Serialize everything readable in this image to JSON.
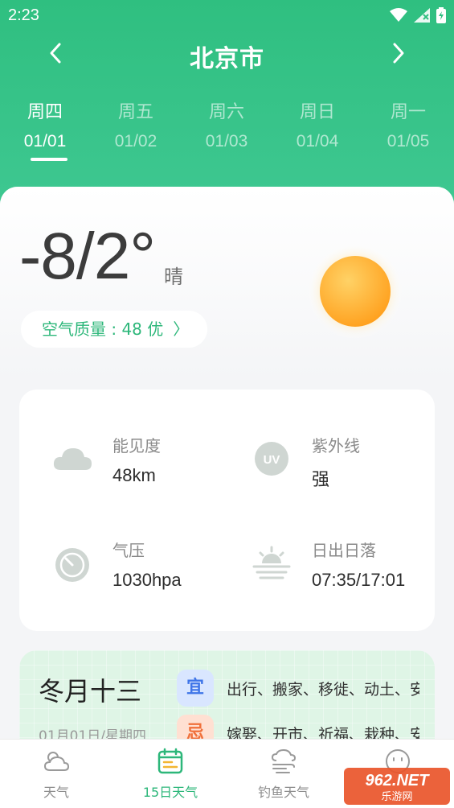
{
  "status_bar": {
    "time": "2:23"
  },
  "nav": {
    "city": "北京市",
    "back_icon": "chevron-left-icon",
    "forward_icon": "chevron-right-icon"
  },
  "days": [
    {
      "weekday": "周四",
      "date": "01/01",
      "active": true
    },
    {
      "weekday": "周五",
      "date": "01/02",
      "active": false
    },
    {
      "weekday": "周六",
      "date": "01/03",
      "active": false
    },
    {
      "weekday": "周日",
      "date": "01/04",
      "active": false
    },
    {
      "weekday": "周一",
      "date": "01/05",
      "active": false
    }
  ],
  "current": {
    "temperature": "-8/2°",
    "condition": "晴",
    "condition_icon": "sun-icon",
    "air_quality": "空气质量 : 48 优",
    "air_quality_chevron": "〉"
  },
  "details": {
    "visibility": {
      "label": "能见度",
      "value": "48km",
      "icon": "cloud-icon"
    },
    "uv": {
      "label": "紫外线",
      "value": "强",
      "icon": "uv-icon",
      "icon_text": "UV"
    },
    "pressure": {
      "label": "气压",
      "value": "1030hpa",
      "icon": "gauge-icon"
    },
    "sunrise_sunset": {
      "label": "日出日落",
      "value": "07:35/17:01",
      "icon": "sunrise-icon"
    }
  },
  "almanac": {
    "lunar_day": "冬月十三",
    "date_line": "01月01日/星期四",
    "yi_label": "宜",
    "yi_items": "出行、搬家、移徙、动土、安",
    "ji_label": "忌",
    "ji_items": "嫁娶、开市、祈福、栽种、安"
  },
  "tabs": [
    {
      "label": "天气",
      "icon": "cloud-sun-icon",
      "active": false
    },
    {
      "label": "15日天气",
      "icon": "calendar-icon",
      "active": true
    },
    {
      "label": "钓鱼天气",
      "icon": "wind-cloud-icon",
      "active": false
    },
    {
      "label": "",
      "icon": "face-icon",
      "active": false
    }
  ],
  "colors": {
    "header_green": "#2fbf80",
    "accent_green": "#2db77a",
    "yi_blue": "#3f75e8",
    "ji_orange": "#f0703a",
    "sun_orange": "#ffb020"
  },
  "watermark": {
    "text": "962.NET",
    "subtext": "乐游网"
  }
}
